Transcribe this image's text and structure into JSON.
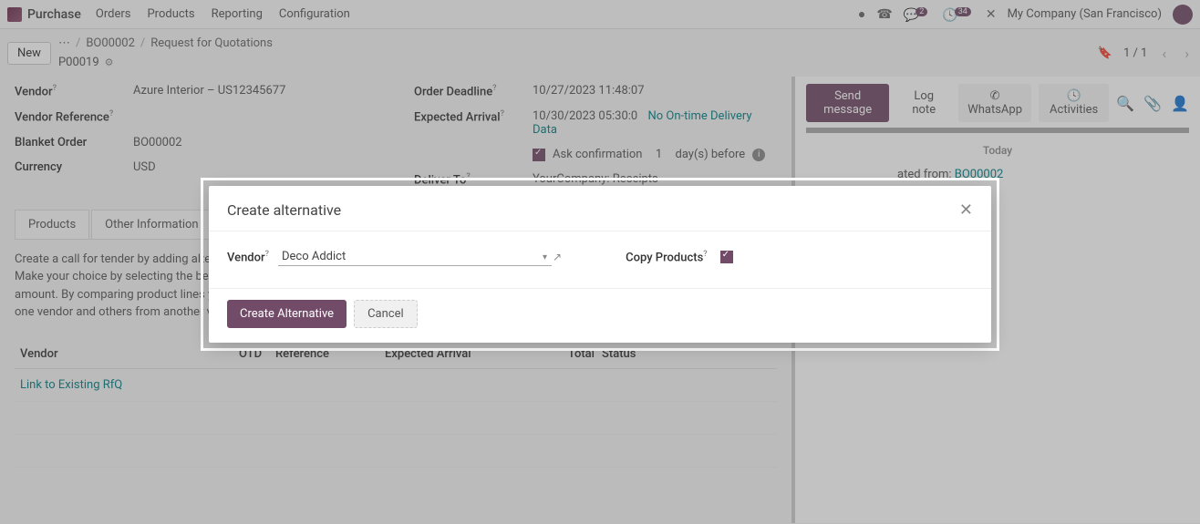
{
  "nav": {
    "brand": "Purchase",
    "menu": [
      "Orders",
      "Products",
      "Reporting",
      "Configuration"
    ],
    "company": "My Company (San Francisco)",
    "chat_badge": "2",
    "activity_badge": "34"
  },
  "breadcrumb": {
    "new_btn": "New",
    "dots": "⋯",
    "bo": "BO00002",
    "rfq": "Request for Quotations",
    "record": "P00019",
    "pager": "1 / 1"
  },
  "form": {
    "vendor_label": "Vendor",
    "vendor_value": "Azure Interior – US12345677",
    "vendor_ref_label": "Vendor Reference",
    "blanket_label": "Blanket Order",
    "blanket_value": "BO00002",
    "currency_label": "Currency",
    "currency_value": "USD",
    "deadline_label": "Order Deadline",
    "deadline_value": "10/27/2023 11:48:07",
    "expected_label": "Expected Arrival",
    "expected_value": "10/30/2023 05:30:0",
    "no_ontime": "No On-time Delivery Data",
    "ask_conf_label": "Ask confirmation",
    "days_value": "1",
    "days_before": "day(s) before",
    "deliver_label": "Deliver To",
    "deliver_value": "YourCompany: Receipts"
  },
  "tabs": {
    "products": "Products",
    "other": "Other Information"
  },
  "tender_text": "Create a call for tender by adding alternative requests for quotation to different vendors. Make your choice by selecting the best combination of lead time, OTD and/or total amount. By comparing product lines you can also decide to order some products from one vendor and others from another vendor.",
  "alt_table": {
    "col_vendor": "Vendor",
    "col_otd": "OTD",
    "col_ref": "Reference",
    "col_exp": "Expected Arrival",
    "col_total": "Total",
    "col_status": "Status",
    "link_existing": "Link to Existing RfQ"
  },
  "chatter": {
    "send": "Send message",
    "log": "Log note",
    "whatsapp": "WhatsApp",
    "activities": "Activities",
    "today": "Today",
    "msg_prefix": "ated from: ",
    "msg_link": "BO00002"
  },
  "modal": {
    "title": "Create alternative",
    "vendor_label": "Vendor",
    "vendor_value": "Deco Addict",
    "copy_label": "Copy Products",
    "create_btn": "Create Alternative",
    "cancel_btn": "Cancel"
  }
}
